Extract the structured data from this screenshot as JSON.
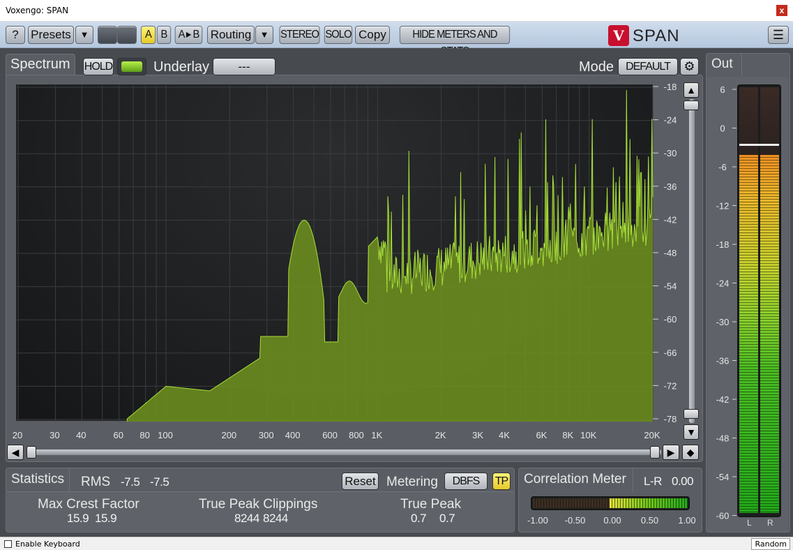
{
  "window": {
    "title": "Voxengo: SPAN",
    "close_label": "x"
  },
  "toolbar": {
    "help": "?",
    "presets": "Presets",
    "dropdown": "▼",
    "a": "A",
    "b": "B",
    "ab": "A ▸ B",
    "routing": "Routing",
    "stereo": "STEREO",
    "solo": "SOLO",
    "copy": "Copy",
    "hide": "HIDE METERS AND STATS",
    "logo_text": "SPAN",
    "menu": "☰"
  },
  "spectrum": {
    "tab": "Spectrum",
    "hold": "HOLD",
    "underlay_label": "Underlay",
    "underlay_value": "---",
    "mode_label": "Mode",
    "mode_value": "DEFAULT",
    "db_ticks": [
      "-18",
      "-24",
      "-30",
      "-36",
      "-42",
      "-48",
      "-54",
      "-60",
      "-66",
      "-72",
      "-78"
    ],
    "freq_ticks": [
      "20",
      "30",
      "40",
      "60",
      "80",
      "100",
      "200",
      "300",
      "400",
      "600",
      "800",
      "1K",
      "2K",
      "3K",
      "4K",
      "6K",
      "8K",
      "10K",
      "20K"
    ],
    "colors": {
      "fill": "#6b8c1f",
      "line": "#a8e03a",
      "grid": "#3a3d40"
    }
  },
  "statistics": {
    "tab": "Statistics",
    "rms_label": "RMS",
    "rms_l": "-7.5",
    "rms_r": "-7.5",
    "reset": "Reset",
    "metering_label": "Metering",
    "metering_value": "DBFS",
    "tp": "TP",
    "crest_label": "Max Crest Factor",
    "crest_l": "15.9",
    "crest_r": "15.9",
    "clip_label": "True Peak Clippings",
    "clip_l": "8244",
    "clip_r": "8244",
    "tpeak_label": "True Peak",
    "tpeak_l": "0.7",
    "tpeak_r": "0.7"
  },
  "correlation": {
    "tab": "Correlation Meter",
    "lr_label": "L-R",
    "lr_value": "0.00",
    "ticks": [
      "-1.00",
      "-0.50",
      "0.00",
      "0.50",
      "1.00"
    ]
  },
  "out": {
    "tab": "Out",
    "ticks": [
      "6",
      "0",
      "-6",
      "-12",
      "-18",
      "-24",
      "-30",
      "-36",
      "-42",
      "-48",
      "-54",
      "-60"
    ],
    "ch_l": "L",
    "ch_r": "R"
  },
  "statusbar": {
    "keyboard": "Enable Keyboard",
    "random": "Random"
  }
}
